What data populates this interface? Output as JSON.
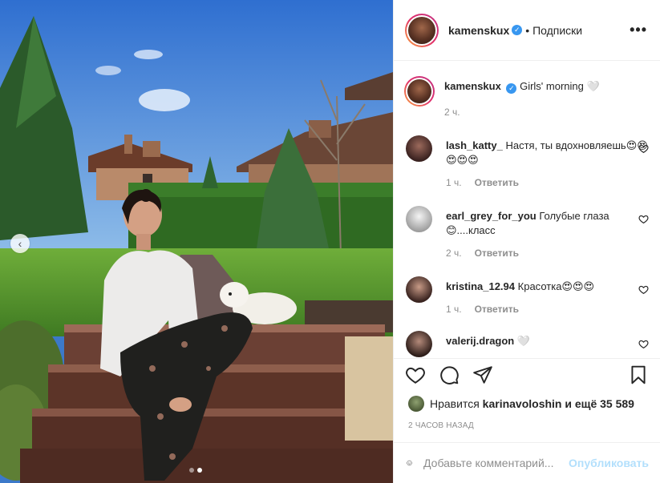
{
  "post": {
    "author": "kamenskux",
    "follow_label": "• Подписки",
    "caption_text": "Girls' morning 🤍",
    "caption_time": "2 ч.",
    "more_label": "•••",
    "verified_glyph": "✓"
  },
  "photo": {
    "prev_icon": "‹",
    "slides_total": 2,
    "slide_active": 2
  },
  "comments": [
    {
      "user": "lash_katty_",
      "text": "Настя, ты вдохновляешь😍😍😍😍😍",
      "time": "1 ч.",
      "reply": "Ответить"
    },
    {
      "user": "earl_grey_for_you",
      "text": "Голубые глаза😊....класс",
      "time": "2 ч.",
      "reply": "Ответить"
    },
    {
      "user": "kristina_12.94",
      "text": "Красотка😍😍😍",
      "time": "1 ч.",
      "reply": "Ответить"
    },
    {
      "user": "valerij.dragon",
      "text": "🤍",
      "time": "",
      "reply": ""
    }
  ],
  "likes": {
    "prefix": "Нравится",
    "user": "karinavoloshin",
    "suffix": "и ещё 35 589"
  },
  "timestamp": "2 часов назад",
  "composer": {
    "placeholder": "Добавьте комментарий...",
    "publish_label": "Опубликовать"
  },
  "colors": {
    "accent": "#3897f0",
    "publish_disabled": "#b2dffc",
    "muted": "#8e8e8e",
    "text": "#262626"
  }
}
